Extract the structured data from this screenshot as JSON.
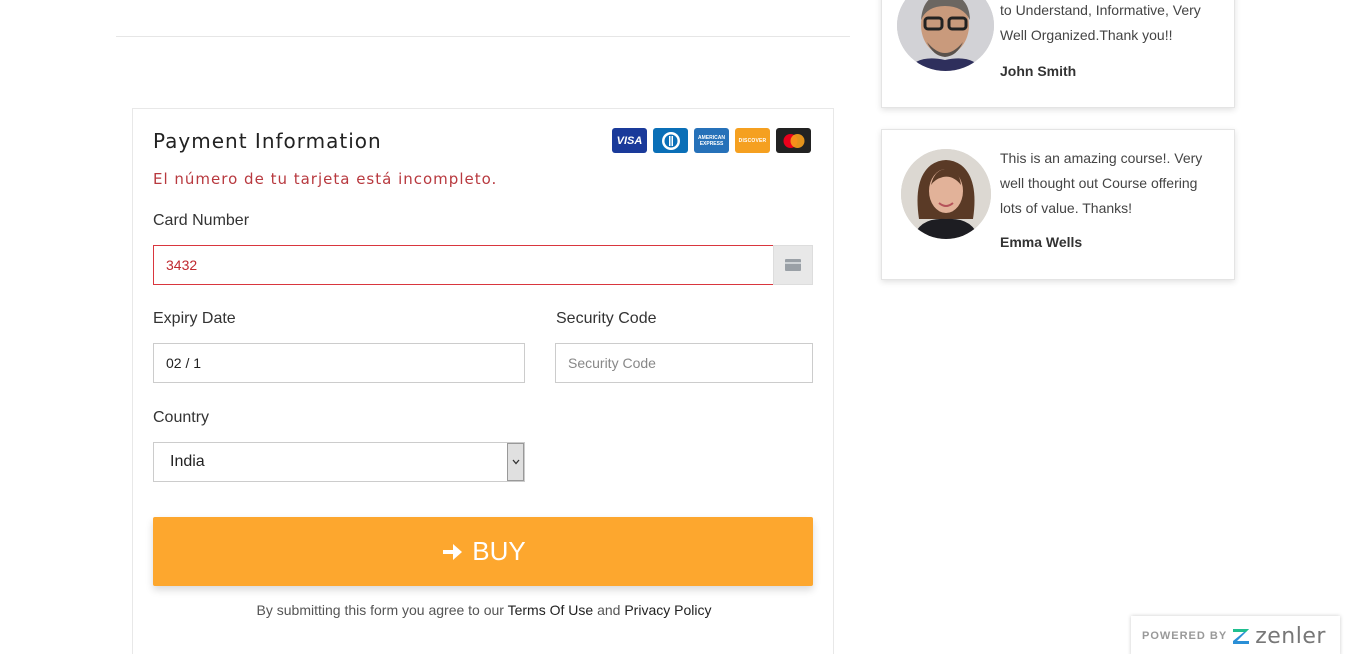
{
  "payment": {
    "title": "Payment Information",
    "error": "El número de tu tarjeta está incompleto.",
    "card_number_label": "Card Number",
    "card_number_value": "3432",
    "expiry_label": "Expiry Date",
    "expiry_value": "02 / 1",
    "security_label": "Security Code",
    "security_placeholder": "Security Code",
    "country_label": "Country",
    "country_value": "India",
    "buy_label": "BUY",
    "terms_prefix": "By submitting this form you agree to our",
    "terms_link": "Terms Of Use",
    "terms_and": "and",
    "privacy_link": "Privacy Policy",
    "card_brands": {
      "visa": "VISA",
      "amex": "AMERICAN EXPRESS",
      "discover": "DISCOVER"
    }
  },
  "testimonials": [
    {
      "quote": "to Understand, Informative, Very Well Organized.Thank you!!",
      "author": "John Smith"
    },
    {
      "quote": "This is an amazing course!. Very well thought out Course offering lots of value. Thanks!",
      "author": "Emma Wells"
    }
  ],
  "powered_by": {
    "prefix": "POWERED BY",
    "brand": "zenler"
  },
  "colors": {
    "buy_button": "#fda72e",
    "error_text": "#b8393f",
    "error_border": "#d9363e"
  },
  "icons": {
    "buy": "arrow-right-icon",
    "card_field": "credit-card-icon",
    "select": "chevron-down-icon"
  }
}
